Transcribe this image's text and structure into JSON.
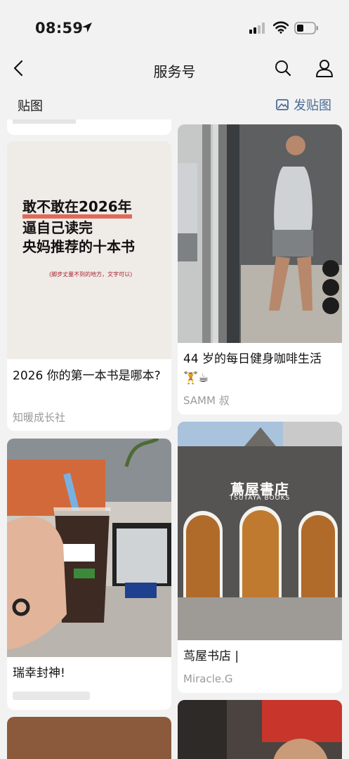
{
  "status_bar": {
    "time": "08:59"
  },
  "nav": {
    "title": "服务号"
  },
  "section": {
    "title": "贴图",
    "post_button": "发贴图"
  },
  "feed": {
    "left": [
      {
        "image_text": {
          "line1": "敢不敢在2026年",
          "line2": "逼自己读完",
          "line3": "央妈推荐的十本书",
          "note": "(脚步丈量不到的地方，文字可以)"
        },
        "title": "2026 你的第一本书是哪本?",
        "author": "知暖成长社"
      },
      {
        "title": "瑞幸封神!",
        "author": ""
      }
    ],
    "right": [
      {
        "title": "44 岁的每日健身咖啡生活🏋️☕",
        "author": "SAMM 叔"
      },
      {
        "image_text": {
          "sign": "蔦屋書店",
          "sign_sub": "TSUTAYA BOOKS"
        },
        "title": "茑屋书店 |",
        "author": "Miracle.G"
      }
    ]
  },
  "colors": {
    "accent": "#4a6c96",
    "background": "#f2f2f2",
    "card": "#ffffff"
  }
}
